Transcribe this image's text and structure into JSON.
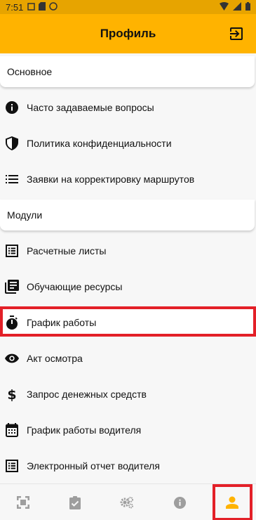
{
  "status_bar": {
    "time": "7:51"
  },
  "app_bar": {
    "title": "Профиль",
    "logout_icon": "logout-icon"
  },
  "sections": {
    "main": "Основное",
    "modules": "Модули"
  },
  "main_items": [
    {
      "label": "Часто задаваемые вопросы",
      "icon": "info-icon"
    },
    {
      "label": "Политика конфиденциальности",
      "icon": "shield-icon"
    },
    {
      "label": "Заявки на корректировку маршрутов",
      "icon": "list-icon"
    }
  ],
  "module_items": [
    {
      "label": "Расчетные листы",
      "icon": "list-alt-icon"
    },
    {
      "label": "Обучающие ресурсы",
      "icon": "library-books-icon"
    },
    {
      "label": "График работы",
      "icon": "timer-icon"
    },
    {
      "label": "Акт осмотра",
      "icon": "eye-icon"
    },
    {
      "label": "Запрос денежных средств",
      "icon": "dollar-icon"
    },
    {
      "label": "График работы водителя",
      "icon": "calendar-icon"
    },
    {
      "label": "Электронный отчет водителя",
      "icon": "list-alt-icon"
    }
  ],
  "bottom_nav": [
    {
      "icon": "fullscreen-icon",
      "active": false
    },
    {
      "icon": "assignment-check-icon",
      "active": false
    },
    {
      "icon": "settings-icon",
      "active": false
    },
    {
      "icon": "info-icon",
      "active": false
    },
    {
      "icon": "person-icon",
      "active": true
    }
  ],
  "colors": {
    "accent": "#ffb300",
    "active_nav": "#ffb300",
    "highlight": "#e32028",
    "nav_inactive": "#9e9e9e"
  }
}
